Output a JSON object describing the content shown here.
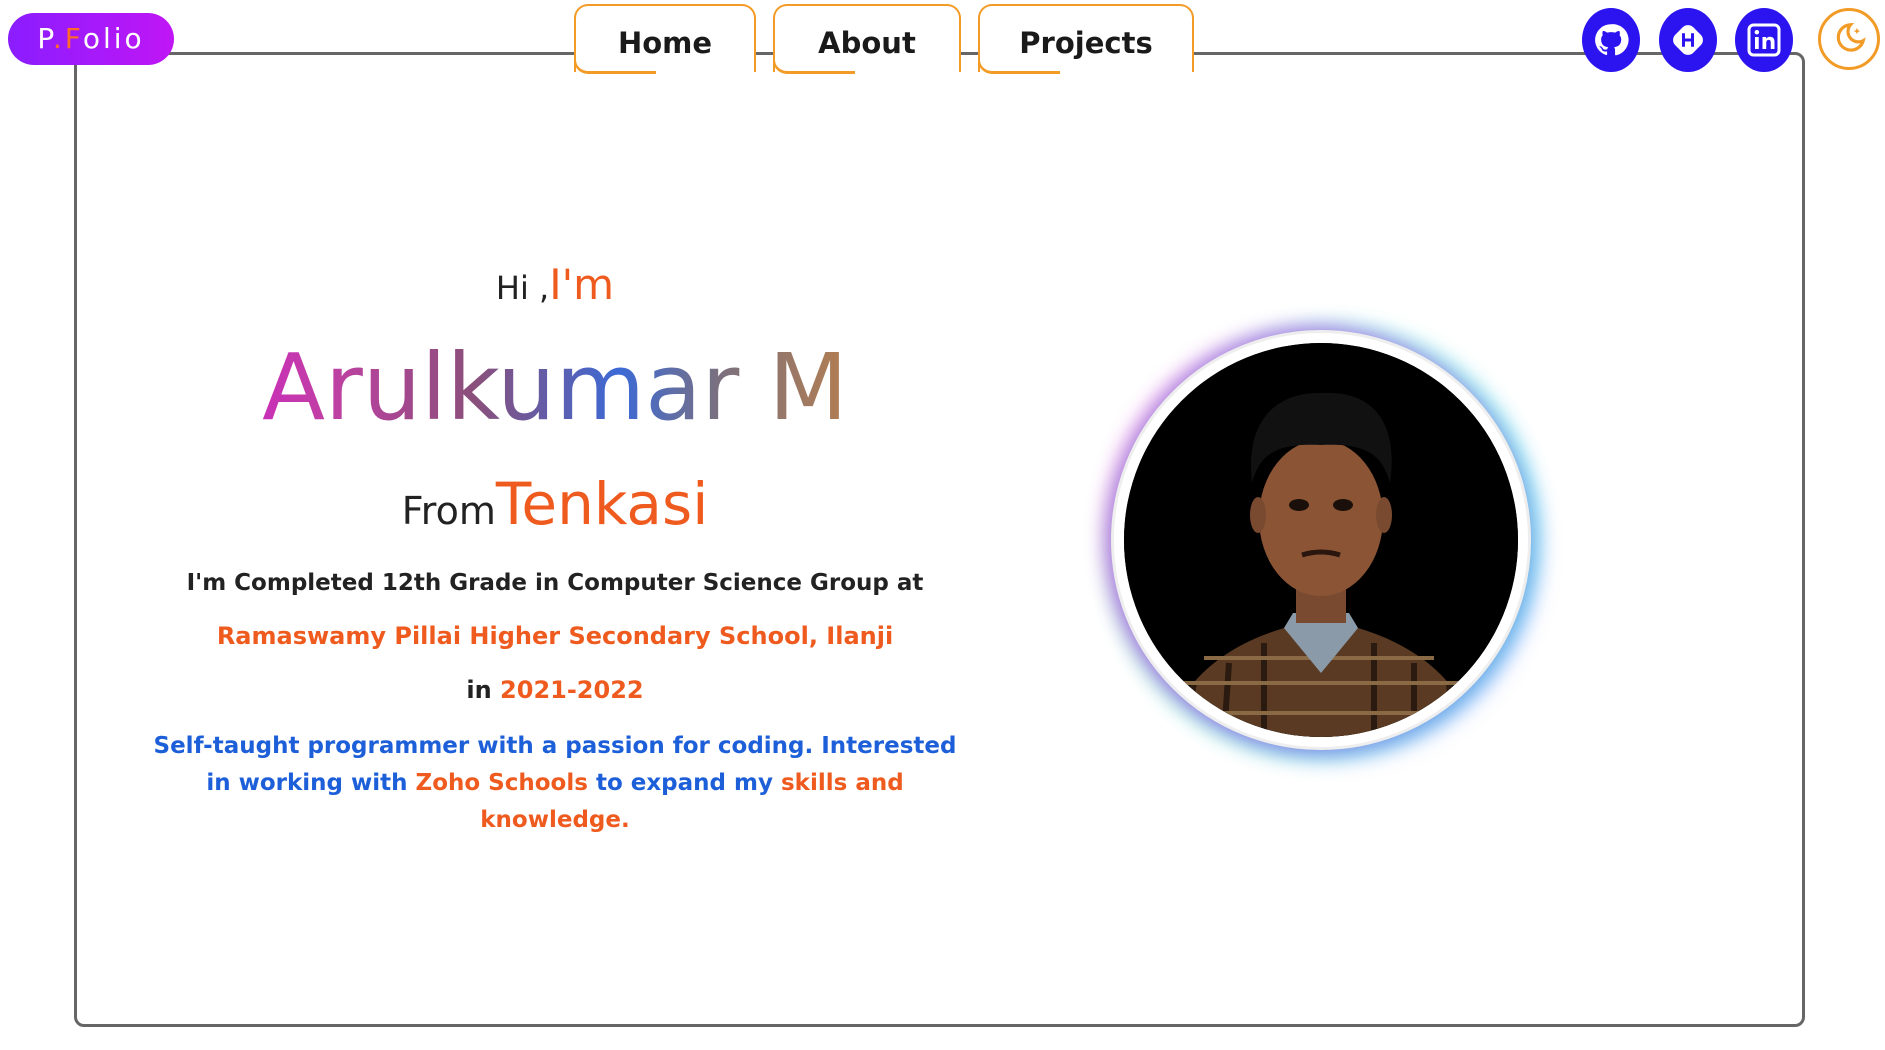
{
  "logo": {
    "prefix": "P",
    "dot": ".",
    "accent": "F",
    "rest": "olio"
  },
  "nav": {
    "home": "Home",
    "about": "About",
    "projects": "Projects"
  },
  "social": [
    "github-icon",
    "hashnode-icon",
    "linkedin-icon"
  ],
  "theme_toggle": "moon-icon",
  "hero": {
    "greet": "Hi ,",
    "greet_accent": "I'm",
    "name": "Arulkumar M",
    "from_label": "From",
    "city": "Tenkasi",
    "line1": "I'm Completed 12th Grade in Computer Science Group at",
    "school": "Ramaswamy Pillai Higher Secondary School, Ilanji",
    "in_label": "in ",
    "years": "2021-2022",
    "bio_1": "Self-taught programmer with a passion for coding. Interested in working with ",
    "bio_zoho": "Zoho Schools",
    "bio_2": " to expand my ",
    "bio_skills": "skills and knowledge."
  },
  "colors": {
    "accent_orange": "#ef5b1f",
    "tab_border": "#f29b26",
    "social_blue": "#2c14f0",
    "bio_blue": "#1d5fd8",
    "logo_purple": "#8a1dff"
  }
}
